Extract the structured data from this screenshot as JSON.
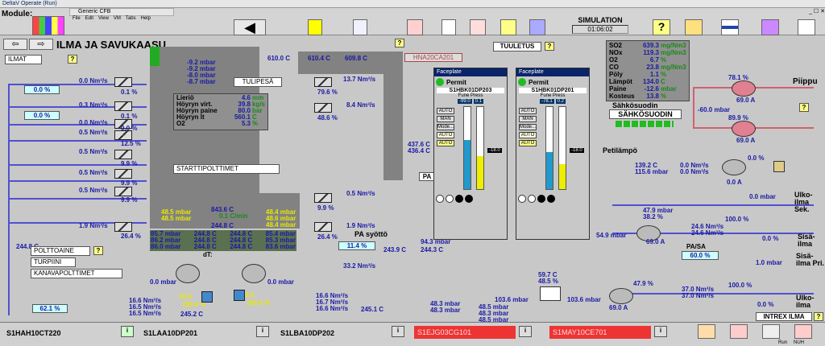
{
  "window": {
    "title": "DeltaV Operate (Run)",
    "inner_title": "Generic CFB",
    "menu": [
      "File",
      "Edit",
      "View",
      "VM",
      "Tabs",
      "Help"
    ]
  },
  "header": {
    "module_label": "Module:",
    "simulation_label": "SIMULATION",
    "time": "01:06:02"
  },
  "page": {
    "title": "ILMA JA SAVUKAASU",
    "ilmat": "ILMAT",
    "tulipesa": "TULIPESÄ",
    "starttipolttimet": "STARTTIPOLTTIMET",
    "tuuletus": "TUULETUS",
    "hna_tag": "HNA20CA201",
    "pa_syotto": "PA syöttö",
    "pa_label": "PA",
    "polttoaine": "POLTTOAINE",
    "turpiini": "TURPIINI",
    "kanavapolttimet": "KANAVAPOLTTIMET",
    "dt_label": "dT:",
    "pa_sa_label": "PA/SA",
    "sahkosuodin_top": "Sähkösuodin",
    "sahkosuodin": "SÄHKÖSUODIN",
    "petilampo": "Petilämpö",
    "piippu": "Piippu",
    "ulko_sek": "Ulko-ilma Sek.",
    "sisa_ilma": "Sisä-ilma",
    "sisa_pri": "Sisä-ilma Pri.",
    "ulko_ilma": "Ulko-ilma",
    "intrex": "INTREX ILMA"
  },
  "left_percent": [
    "0.0 %",
    "0.0 %",
    "62.1 %"
  ],
  "left_flows": [
    "0.0 Nm³/s",
    "0.3 Nm³/s",
    "0.0 Nm³/s",
    "0.5 Nm³/s",
    "0.5 Nm³/s",
    "0.5 Nm³/s",
    "0.5 Nm³/s",
    "1.9 Nm³/s"
  ],
  "left_valve_pct": [
    "0.1 %",
    "0.1 %",
    "0.0 %",
    "12.5 %",
    "9.9 %",
    "9.9 %",
    "9.9 %",
    "26.4 %"
  ],
  "furnace_pressures": [
    "-9.2 mbar",
    "-9.2 mbar",
    "-8.0 mbar",
    "-8.7 mbar"
  ],
  "top_temps": [
    "610.0 C",
    "610.4 C",
    "609.8 C"
  ],
  "boiler": [
    {
      "label": "Lieriö",
      "value": "4.6",
      "unit": "mm"
    },
    {
      "label": "Höyryn virt.",
      "value": "39.8",
      "unit": "kg/s"
    },
    {
      "label": "Höyryn paine",
      "value": "80.0",
      "unit": "bar"
    },
    {
      "label": "Höyryn lt",
      "value": "560.1",
      "unit": "C"
    },
    {
      "label": "O2",
      "value": "5.3",
      "unit": "%"
    }
  ],
  "right_flows": [
    "13.7 Nm³/s",
    "8.4 Nm³/s",
    "0.5 Nm³/s",
    "1.9 Nm³/s"
  ],
  "right_valve_pct": [
    "79.6 %",
    "48.6 %",
    "9.9 %",
    "26.4 %"
  ],
  "mid_values": {
    "cmin": "0.1 C/min",
    "temp_center": "843.6 C",
    "t244": "244.8 C",
    "y1": "48.5 mbar",
    "y2": "48.5 mbar",
    "y3": "48.4 mbar",
    "y4": "48.6 mbar",
    "y5": "48.4 mbar",
    "y6": "48.3 mbar",
    "l1": "244.8 C"
  },
  "bed_table": [
    [
      "85.7 mbar",
      "244.8 C",
      "244.8 C",
      "85.4 mbar"
    ],
    [
      "86.2 mbar",
      "244.8 C",
      "244.8 C",
      "85.3 mbar"
    ],
    [
      "86.0 mbar",
      "244.8 C",
      "244.8 C",
      "83.6 mbar"
    ]
  ],
  "pa_values": {
    "pct": "11.4 %",
    "temp1": "243.9 C",
    "p1": "94.3 mbar",
    "t2": "244.3 C",
    "p2": "33.2 Nm³/s",
    "b1": "48.3 mbar",
    "b2": "48.3 mbar",
    "b3": "48.5 mbar",
    "b4": "48.3 mbar",
    "b5": "48.5 mbar"
  },
  "bottom_left": {
    "mbar1": "0.0 mbar",
    "mbar2": "0.0 mbar",
    "f1": "16.6 Nm³/s",
    "f2": "16.5 Nm³/s",
    "f3": "16.5 Nm³/s",
    "f4": "16.6 Nm³/s",
    "f5": "16.7 Nm³/s",
    "f6": "16.6 Nm³/s",
    "t1": "245.2 C",
    "t2": "245.1 C",
    "pct1": "100.0 %",
    "pct2": "100.0 %",
    "yv1": "16.6",
    "yv2": "16.6"
  },
  "emissions": [
    {
      "label": "SO2",
      "value": "639.3",
      "unit": "mg/Nm3"
    },
    {
      "label": "NOx",
      "value": "119.3",
      "unit": "mg/Nm3"
    },
    {
      "label": "O2",
      "value": "6.7",
      "unit": "%"
    },
    {
      "label": "CO",
      "value": "23.8",
      "unit": "mg/Nm3"
    },
    {
      "label": "Pöly",
      "value": "1.1",
      "unit": "%"
    },
    {
      "label": "Lämpöt",
      "value": "134.0",
      "unit": "C"
    },
    {
      "label": "Paine",
      "value": "-12.6",
      "unit": "mbar"
    },
    {
      "label": "Kosteus",
      "value": "13.8",
      "unit": "%"
    }
  ],
  "flue_right": {
    "a1": "78.1 %",
    "a2": "69.0 A",
    "a3": "-60.0 mbar",
    "a4": "89.9 %",
    "a5": "69.0 A",
    "a6": "139.2 C",
    "a7": "115.6 mbar",
    "a8": "0.0 Nm³/s",
    "a9": "0.0 Nm³/s",
    "a10": "0.0 %",
    "a11": "0.0 A",
    "a12": "0.0 mbar",
    "a13": "100.0 %",
    "a14": "47.9 mbar",
    "a15": "38.2 %",
    "a16": "54.9 mbar",
    "a17": "69.0 A",
    "a18": "24.6 Nm³/s",
    "a19": "24.6 Nm³/s",
    "a20": "0.0 %",
    "a21": "60.0 %",
    "a22": "1.0 mbar",
    "a23": "100.0 %",
    "a24": "59.7 C",
    "a25": "48.5 %",
    "a26": "103.6 mbar",
    "a27": "103.6 mbar",
    "a28": "47.9 %",
    "a29": "69.0 A",
    "a30": "37.0 Nm³/s",
    "a31": "37.0 Nm³/s",
    "a32": "0.0 %",
    "a33": "437.6 C",
    "a34": "436.4 C",
    "a35": "437.6 C"
  },
  "faceplates": [
    {
      "title": "Faceplate",
      "permit": "Permit",
      "tag": "S1HBK01DP203",
      "sub": "Fune Press",
      "v1": "-99.0",
      "v2": "0.1",
      "v3": "-18.0",
      "btns": [
        "AUTO",
        "MAN",
        "Mode...",
        "AUTO",
        "AUTO"
      ]
    },
    {
      "title": "Faceplate",
      "permit": "Permit",
      "tag": "S1HBK01DP201",
      "sub": "Fune Press",
      "v1": "-78.1",
      "v2": "0.2",
      "v3": "-18.0",
      "btns": [
        "AUTO",
        "MAN",
        "Mode...",
        "AUTO",
        "AUTO"
      ]
    }
  ],
  "status": [
    "S1HAH10CT220",
    "S1LAA10DP201",
    "S1LBA10DP202",
    "S1EJG03CG101",
    "S1MAY10CE701"
  ],
  "status_right": [
    "Run",
    "NUH"
  ],
  "colors": {
    "accent": "#0a246a",
    "flow_blue": "#5050d0",
    "flue_pink": "#d06070",
    "yellow": "#e8e800"
  }
}
